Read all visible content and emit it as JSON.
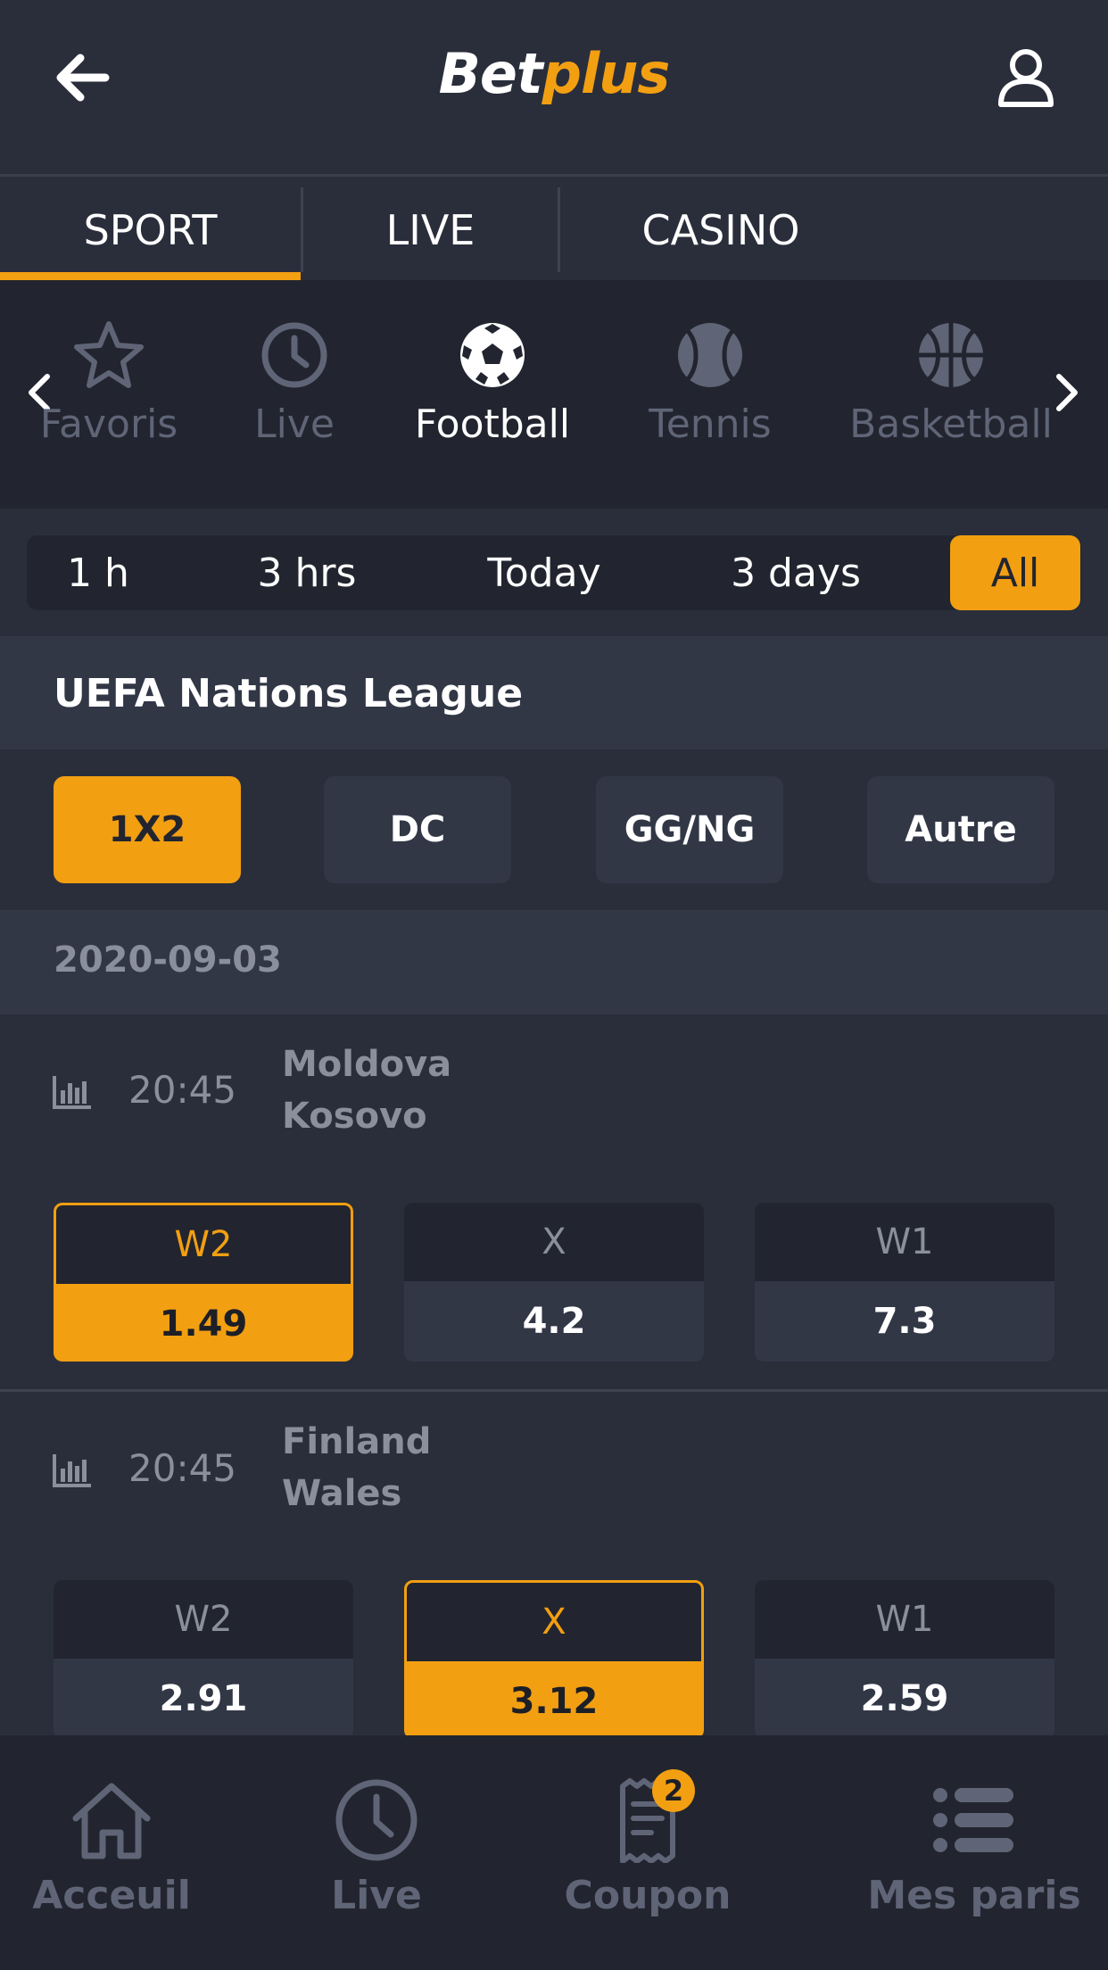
{
  "header": {
    "logo_part1": "Bet",
    "logo_part2": "plus",
    "back_icon": "arrow-left-icon",
    "user_icon": "user-icon"
  },
  "tabs": [
    {
      "label": "SPORT",
      "active": true
    },
    {
      "label": "LIVE",
      "active": false
    },
    {
      "label": "CASINO",
      "active": false
    }
  ],
  "sports": [
    {
      "label": "Favoris",
      "icon": "star-icon",
      "active": false
    },
    {
      "label": "Live",
      "icon": "clock-icon",
      "active": false
    },
    {
      "label": "Football",
      "icon": "soccer-ball-icon",
      "active": true
    },
    {
      "label": "Tennis",
      "icon": "tennis-ball-icon",
      "active": false
    },
    {
      "label": "Basketball",
      "icon": "basketball-icon",
      "active": false
    }
  ],
  "time_filters": [
    {
      "label": "1 h",
      "active": false
    },
    {
      "label": "3 hrs",
      "active": false
    },
    {
      "label": "Today",
      "active": false
    },
    {
      "label": "3 days",
      "active": false
    },
    {
      "label": "All",
      "active": true
    }
  ],
  "league": {
    "title": "UEFA Nations League"
  },
  "markets": [
    {
      "label": "1X2",
      "active": true
    },
    {
      "label": "DC",
      "active": false
    },
    {
      "label": "GG/NG",
      "active": false
    },
    {
      "label": "Autre",
      "active": false
    }
  ],
  "date": "2020-09-03",
  "matches": [
    {
      "time": "20:45",
      "team1": "Moldova",
      "team2": "Kosovo",
      "odds": [
        {
          "label": "W2",
          "value": "1.49",
          "selected": true
        },
        {
          "label": "X",
          "value": "4.2",
          "selected": false
        },
        {
          "label": "W1",
          "value": "7.3",
          "selected": false
        }
      ]
    },
    {
      "time": "20:45",
      "team1": "Finland",
      "team2": "Wales",
      "odds": [
        {
          "label": "W2",
          "value": "2.91",
          "selected": false
        },
        {
          "label": "X",
          "value": "3.12",
          "selected": true
        },
        {
          "label": "W1",
          "value": "2.59",
          "selected": false
        }
      ]
    }
  ],
  "bottom_nav": [
    {
      "label": "Acceuil",
      "icon": "home-icon"
    },
    {
      "label": "Live",
      "icon": "clock-icon"
    },
    {
      "label": "Coupon",
      "icon": "receipt-icon",
      "badge": "2"
    },
    {
      "label": "Mes paris",
      "icon": "list-icon"
    }
  ],
  "colors": {
    "accent": "#f29f12",
    "background": "#2a2e3b",
    "panel_dark": "#22252f",
    "panel_light": "#323746",
    "muted_text": "#8a8f9c"
  }
}
